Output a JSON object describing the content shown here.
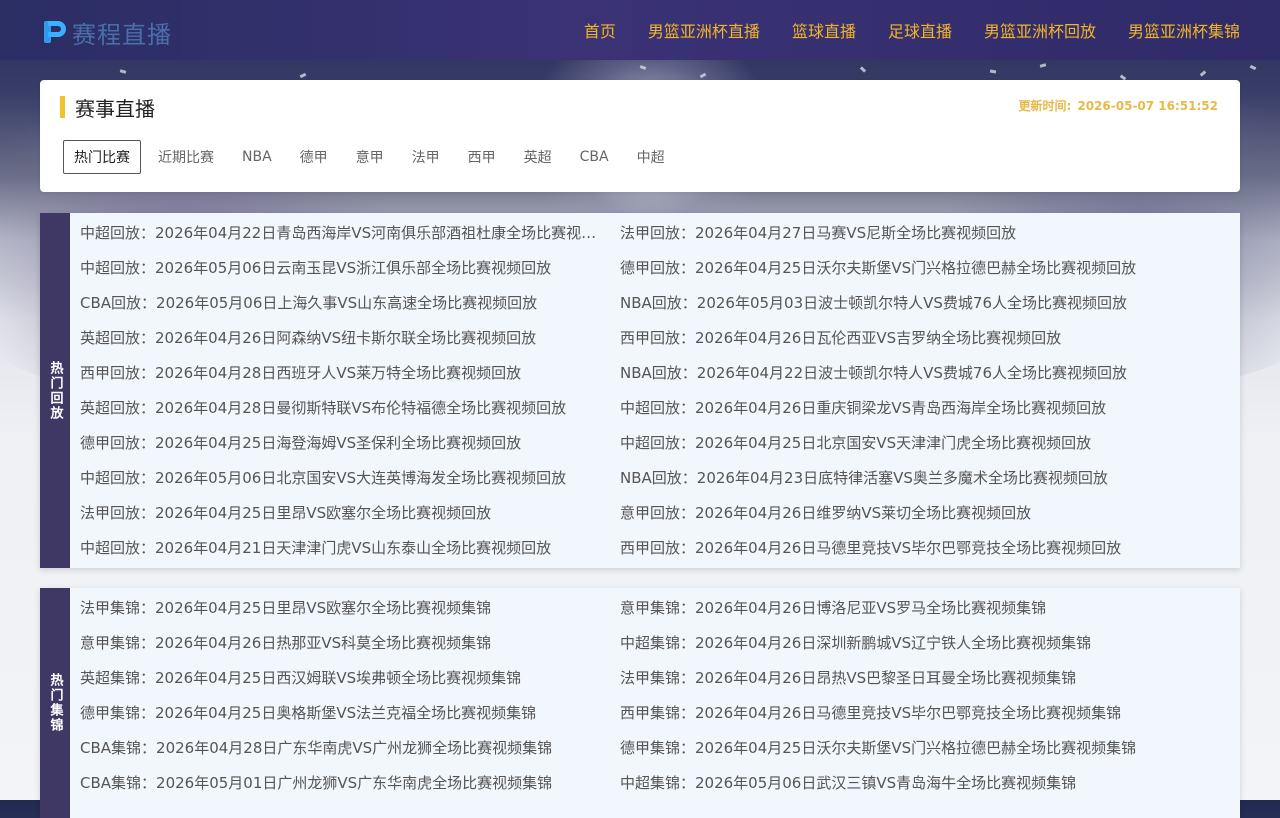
{
  "header": {
    "logo_text": "赛程直播",
    "nav": [
      "首页",
      "男篮亚洲杯直播",
      "篮球直播",
      "足球直播",
      "男篮亚洲杯回放",
      "男篮亚洲杯集锦"
    ]
  },
  "live": {
    "title": "赛事直播",
    "update_label": "更新时间:",
    "update_time": "2026-05-07 16:51:52",
    "tabs": [
      "热门比赛",
      "近期比赛",
      "NBA",
      "德甲",
      "意甲",
      "法甲",
      "西甲",
      "英超",
      "CBA",
      "中超"
    ],
    "active_tab": 0
  },
  "replays": {
    "side_label": "热门回放",
    "items": [
      "中超回放：2026年04月22日青岛西海岸VS河南俱乐部酒祖杜康全场比赛视频回放",
      "法甲回放：2026年04月27日马赛VS尼斯全场比赛视频回放",
      "中超回放：2026年05月06日云南玉昆VS浙江俱乐部全场比赛视频回放",
      "德甲回放：2026年04月25日沃尔夫斯堡VS门兴格拉德巴赫全场比赛视频回放",
      "CBA回放：2026年05月06日上海久事VS山东高速全场比赛视频回放",
      "NBA回放：2026年05月03日波士顿凯尔特人VS费城76人全场比赛视频回放",
      "英超回放：2026年04月26日阿森纳VS纽卡斯尔联全场比赛视频回放",
      "西甲回放：2026年04月26日瓦伦西亚VS吉罗纳全场比赛视频回放",
      "西甲回放：2026年04月28日西班牙人VS莱万特全场比赛视频回放",
      "NBA回放：2026年04月22日波士顿凯尔特人VS费城76人全场比赛视频回放",
      "英超回放：2026年04月28日曼彻斯特联VS布伦特福德全场比赛视频回放",
      "中超回放：2026年04月26日重庆铜梁龙VS青岛西海岸全场比赛视频回放",
      "德甲回放：2026年04月25日海登海姆VS圣保利全场比赛视频回放",
      "中超回放：2026年04月25日北京国安VS天津津门虎全场比赛视频回放",
      "中超回放：2026年05月06日北京国安VS大连英博海发全场比赛视频回放",
      "NBA回放：2026年04月23日底特律活塞VS奥兰多魔术全场比赛视频回放",
      "法甲回放：2026年04月25日里昂VS欧塞尔全场比赛视频回放",
      "意甲回放：2026年04月26日维罗纳VS莱切全场比赛视频回放",
      "中超回放：2026年04月21日天津津门虎VS山东泰山全场比赛视频回放",
      "西甲回放：2026年04月26日马德里竞技VS毕尔巴鄂竞技全场比赛视频回放"
    ]
  },
  "highlights": {
    "side_label": "热门集锦",
    "items": [
      "法甲集锦：2026年04月25日里昂VS欧塞尔全场比赛视频集锦",
      "意甲集锦：2026年04月26日博洛尼亚VS罗马全场比赛视频集锦",
      "意甲集锦：2026年04月26日热那亚VS科莫全场比赛视频集锦",
      "中超集锦：2026年04月26日深圳新鹏城VS辽宁铁人全场比赛视频集锦",
      "英超集锦：2026年04月25日西汉姆联VS埃弗顿全场比赛视频集锦",
      "法甲集锦：2026年04月26日昂热VS巴黎圣日耳曼全场比赛视频集锦",
      "德甲集锦：2026年04月25日奥格斯堡VS法兰克福全场比赛视频集锦",
      "西甲集锦：2026年04月26日马德里竞技VS毕尔巴鄂竞技全场比赛视频集锦",
      "CBA集锦：2026年04月28日广东华南虎VS广州龙狮全场比赛视频集锦",
      "德甲集锦：2026年04月25日沃尔夫斯堡VS门兴格拉德巴赫全场比赛视频集锦",
      "CBA集锦：2026年05月01日广州龙狮VS广东华南虎全场比赛视频集锦",
      "中超集锦：2026年05月06日武汉三镇VS青岛海牛全场比赛视频集锦"
    ]
  }
}
